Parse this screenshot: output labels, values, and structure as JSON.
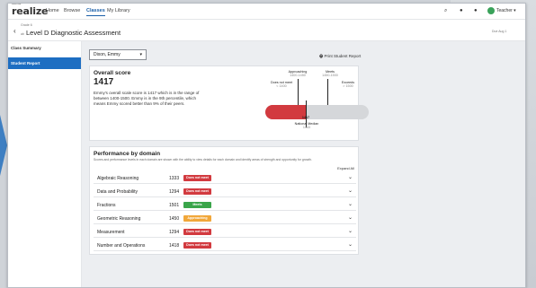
{
  "app": {
    "logo": "realize",
    "logo_top": "savvas"
  },
  "nav": {
    "items": [
      "Home",
      "Browse",
      "Classes",
      "My Library"
    ],
    "active_index": 2
  },
  "header": {
    "user_name": "Teacher"
  },
  "subheader": {
    "breadcrumb": "Grade 6",
    "title": "Level D Diagnostic Assessment",
    "due": "Due Aug 1"
  },
  "sidebar": {
    "items": [
      {
        "label": "Class Summary"
      },
      {
        "label": "Student Report"
      }
    ],
    "active_index": 1
  },
  "student_select": {
    "value": "Dixon, Emmy"
  },
  "print_label": "Print Student Report",
  "overall": {
    "title": "Overall score",
    "score": "1417",
    "description": "Emmy's overall scale score is 1417 which is in the range of between 1400-1500. Emmy is in the 9th percentile, which means Emmy scored better than 9% of their peers.",
    "progress": 0.39,
    "labels": {
      "approaching": "Approaching",
      "approaching_range": "1400-1450",
      "meets": "Meets",
      "meets_range": "1450-1500",
      "does_not_meet": "Does not meet",
      "does_not_meet_range": "< 1400",
      "exceeds": "Exceeds",
      "exceeds_range": "> 1500",
      "marker_score": "1417",
      "national_median": "National Median",
      "national_median_value": "1443"
    }
  },
  "performance": {
    "title": "Performance by domain",
    "description": "Scores and performance levels in each domain are shown with the ability to view details for each domain and identify areas of strength and opportunity for growth.",
    "expand_label": "Expand All",
    "domains": [
      {
        "name": "Algebraic Reasoning",
        "score": "1333",
        "status": "Does not meet",
        "color": "#d23a3f"
      },
      {
        "name": "Data and Probability",
        "score": "1294",
        "status": "Does not meet",
        "color": "#d23a3f"
      },
      {
        "name": "Fractions",
        "score": "1501",
        "status": "Meets",
        "color": "#3aa54a"
      },
      {
        "name": "Geometric Reasoning",
        "score": "1450",
        "status": "Approaching",
        "color": "#f1a73a"
      },
      {
        "name": "Measurement",
        "score": "1294",
        "status": "Does not meet",
        "color": "#d23a3f"
      },
      {
        "name": "Number and Operations",
        "score": "1418",
        "status": "Does not meet",
        "color": "#d23a3f"
      }
    ]
  },
  "colors": {
    "accent": "#1d6ec2",
    "does_not_meet": "#d23a3f",
    "meets": "#3aa54a",
    "approaching": "#f1a73a"
  }
}
